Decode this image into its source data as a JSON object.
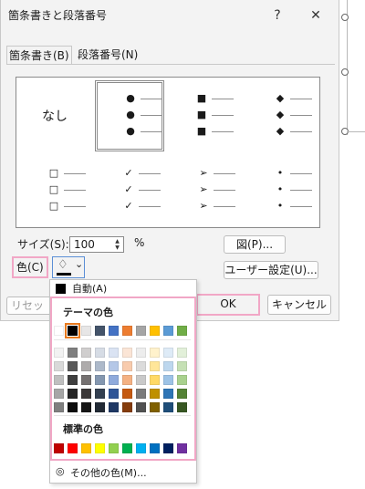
{
  "dialog": {
    "title": "箇条書きと段落番号",
    "help_glyph": "?",
    "close_glyph": "✕"
  },
  "tabs": [
    {
      "label": "箇条書き(B)"
    },
    {
      "label": "段落番号(N)"
    }
  ],
  "gallery": {
    "none_label": "なし",
    "rows": [
      [
        {
          "glyph": "●"
        },
        {
          "glyph": "■"
        },
        {
          "glyph": "◆"
        }
      ],
      [
        {
          "glyph": "□"
        },
        {
          "glyph": "✓"
        },
        {
          "glyph": "➢"
        },
        {
          "glyph": "•"
        }
      ]
    ]
  },
  "size": {
    "label": "サイズ(S):",
    "value": "100",
    "unit": "%"
  },
  "color": {
    "label": "色(C)",
    "chevron": "⌄"
  },
  "buttons": {
    "picture": "図(P)...",
    "custom": "ユーザー設定(U)...",
    "reset": "リセット(",
    "ok": "OK",
    "cancel": "キャンセル"
  },
  "palette": {
    "automatic_label": "自動(A)",
    "theme_heading": "テーマの色",
    "standard_heading": "標準の色",
    "more_colors_label": "その他の色(M)...",
    "theme_top": [
      "#ffffff",
      "#000000",
      "#e7e6e6",
      "#44546a",
      "#4472c4",
      "#ed7d31",
      "#a5a5a5",
      "#ffc000",
      "#5b9bd5",
      "#70ad47"
    ],
    "theme_shades": [
      [
        "#f2f2f2",
        "#7f7f7f",
        "#d0cece",
        "#d6dce5",
        "#dae3f3",
        "#fbe5d6",
        "#ededed",
        "#fff2cc",
        "#deebf7",
        "#e2f0d9"
      ],
      [
        "#d9d9d9",
        "#595959",
        "#aeabab",
        "#adb9ca",
        "#b4c7e7",
        "#f8cbad",
        "#dbdbdb",
        "#ffe699",
        "#bdd7ee",
        "#c5e0b4"
      ],
      [
        "#bfbfbf",
        "#3f3f3f",
        "#757171",
        "#8497b0",
        "#8faadc",
        "#f4b183",
        "#c9c9c9",
        "#ffd966",
        "#9dc3e6",
        "#a9d18e"
      ],
      [
        "#a6a6a6",
        "#262626",
        "#3b3838",
        "#333f50",
        "#2f5597",
        "#c55a11",
        "#7b7b7b",
        "#bf9000",
        "#2e75b6",
        "#548235"
      ],
      [
        "#7f7f7f",
        "#0d0d0d",
        "#161616",
        "#222a35",
        "#1f3864",
        "#843c0c",
        "#525252",
        "#7f6000",
        "#1f4e79",
        "#385723"
      ]
    ],
    "standard": [
      "#c00000",
      "#ff0000",
      "#ffc000",
      "#ffff00",
      "#92d050",
      "#00b050",
      "#00b0f0",
      "#0070c0",
      "#002060",
      "#7030a0"
    ]
  }
}
